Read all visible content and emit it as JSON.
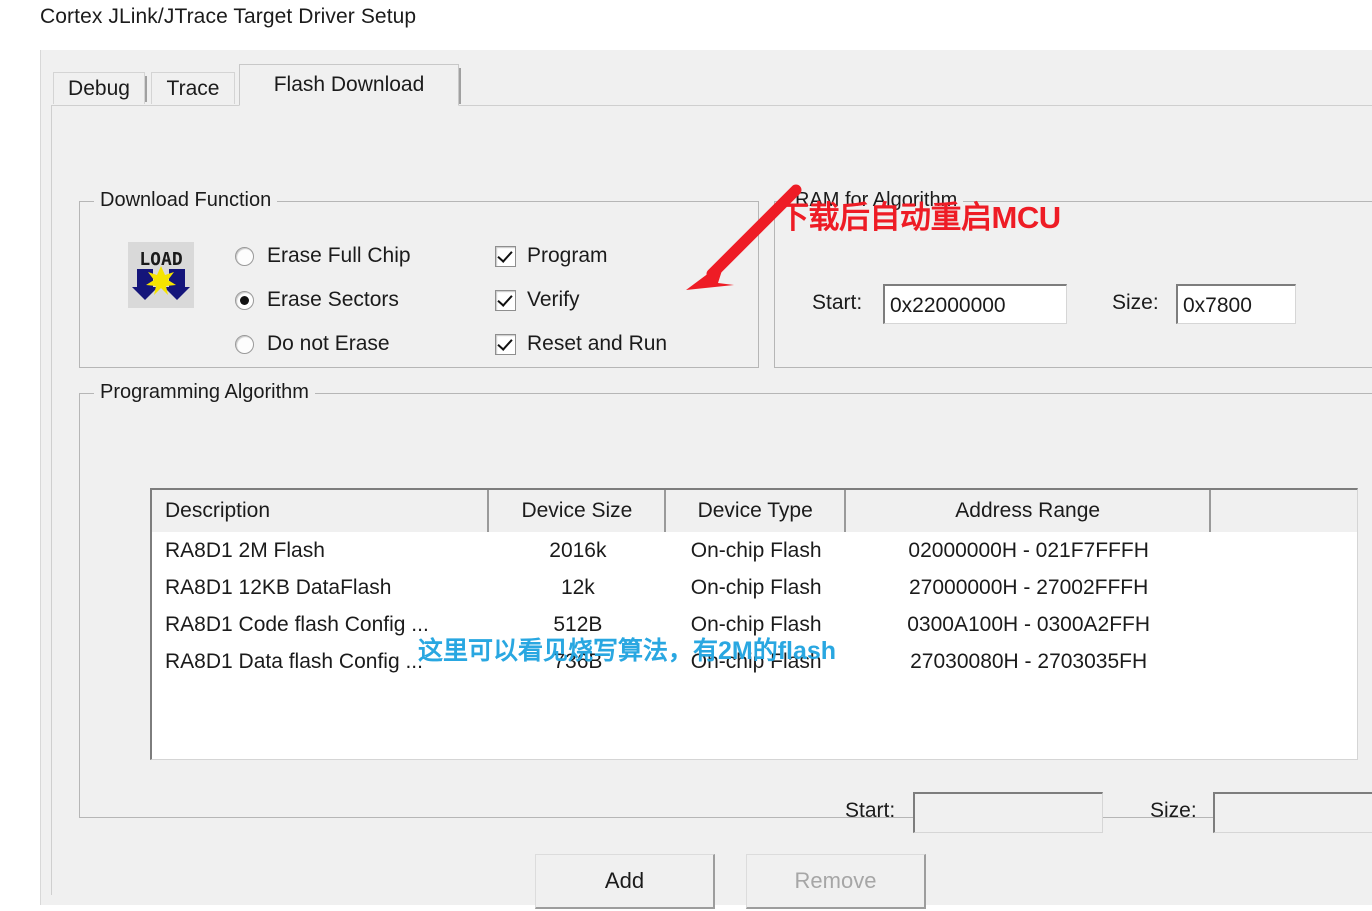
{
  "window": {
    "title": "Cortex JLink/JTrace Target Driver Setup"
  },
  "tabs": [
    {
      "label": "Debug",
      "active": false
    },
    {
      "label": "Trace",
      "active": false
    },
    {
      "label": "Flash Download",
      "active": true
    }
  ],
  "download_function": {
    "group_label": "Download Function",
    "icon_label": "LOAD",
    "erase_options": [
      {
        "label": "Erase Full Chip",
        "selected": false
      },
      {
        "label": "Erase Sectors",
        "selected": true
      },
      {
        "label": "Do not Erase",
        "selected": false
      }
    ],
    "checkboxes": [
      {
        "label": "Program",
        "checked": true
      },
      {
        "label": "Verify",
        "checked": true
      },
      {
        "label": "Reset and Run",
        "checked": true
      }
    ]
  },
  "ram_for_algorithm": {
    "group_label": "RAM for Algorithm",
    "start_label": "Start:",
    "start_value": "0x22000000",
    "size_label": "Size:",
    "size_value": "0x7800"
  },
  "programming_algorithm": {
    "group_label": "Programming Algorithm",
    "columns": [
      "Description",
      "Device Size",
      "Device Type",
      "Address Range",
      ""
    ],
    "rows": [
      {
        "description": "RA8D1 2M Flash",
        "device_size": "2016k",
        "device_type": "On-chip Flash",
        "address_range": "02000000H - 021F7FFFH",
        "extra": ""
      },
      {
        "description": "RA8D1 12KB DataFlash",
        "device_size": "12k",
        "device_type": "On-chip Flash",
        "address_range": "27000000H - 27002FFFH",
        "extra": ""
      },
      {
        "description": "RA8D1 Code flash Config ...",
        "device_size": "512B",
        "device_type": "On-chip Flash",
        "address_range": "0300A100H - 0300A2FFH",
        "extra": ""
      },
      {
        "description": "RA8D1 Data flash Config ...",
        "device_size": "736B",
        "device_type": "On-chip Flash",
        "address_range": "27030080H - 2703035FH",
        "extra": ""
      }
    ],
    "start_label": "Start:",
    "start_value": "",
    "size_label": "Size:",
    "size_value": ""
  },
  "buttons": {
    "add": {
      "label": "Add",
      "enabled": true
    },
    "remove": {
      "label": "Remove",
      "enabled": false
    }
  },
  "annotations": {
    "red_note": "下载后自动重启MCU",
    "red_color": "#ee1c25",
    "blue_note": "这里可以看见烧写算法，有2M的flash",
    "blue_color": "#29a7e1",
    "arrow_icon": "red-arrow-down-left"
  }
}
